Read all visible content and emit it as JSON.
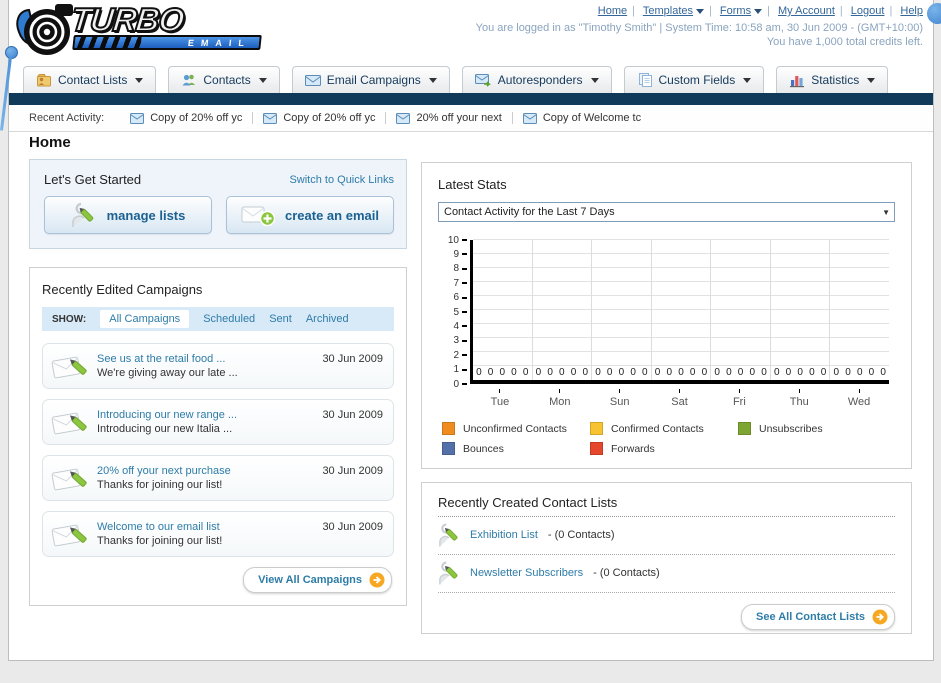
{
  "brand": {
    "name_top": "TURBO",
    "name_bottom": "EMAIL"
  },
  "header": {
    "links": [
      "Home",
      "Templates",
      "Forms",
      "My Account",
      "Logout",
      "Help"
    ],
    "login_info": "You are logged in as \"Timothy Smith\" | System Time: 10:58 am, 30 Jun 2009 - (GMT+10:00)",
    "credits_info": "You have 1,000 total credits left."
  },
  "nav": {
    "tabs": [
      {
        "label": "Contact Lists",
        "icon": "contact-lists-icon"
      },
      {
        "label": "Contacts",
        "icon": "contacts-icon"
      },
      {
        "label": "Email Campaigns",
        "icon": "email-campaigns-icon"
      },
      {
        "label": "Autoresponders",
        "icon": "autoresponders-icon"
      },
      {
        "label": "Custom Fields",
        "icon": "custom-fields-icon"
      },
      {
        "label": "Statistics",
        "icon": "statistics-icon"
      }
    ]
  },
  "recent_activity": {
    "label": "Recent Activity:",
    "items": [
      "Copy of 20% off yc",
      "Copy of 20% off yc",
      "20% off your next",
      "Copy of Welcome tc"
    ]
  },
  "page": {
    "title": "Home"
  },
  "get_started": {
    "title": "Let's Get Started",
    "switch_link": "Switch to Quick Links",
    "manage_lists_label": "manage lists",
    "create_email_label": "create an email"
  },
  "campaigns": {
    "title": "Recently Edited Campaigns",
    "show_label": "SHOW:",
    "filters": [
      "All Campaigns",
      "Scheduled",
      "Sent",
      "Archived"
    ],
    "active_filter": "All Campaigns",
    "items": [
      {
        "title": "See us at the retail food ...",
        "subtitle": "We're giving away our late ...",
        "date": "30 Jun 2009"
      },
      {
        "title": "Introducing our new range ...",
        "subtitle": "Introducing our new Italia ...",
        "date": "30 Jun 2009"
      },
      {
        "title": "20% off your next purchase",
        "subtitle": "Thanks for joining our list!",
        "date": "30 Jun 2009"
      },
      {
        "title": "Welcome to our email list",
        "subtitle": "Thanks for joining our list!",
        "date": "30 Jun 2009"
      }
    ],
    "view_all_label": "View All Campaigns"
  },
  "stats": {
    "title": "Latest Stats",
    "dropdown_value": "Contact Activity for the Last 7 Days"
  },
  "chart_data": {
    "type": "bar",
    "title": "Contact Activity for the Last 7 Days",
    "categories": [
      "Tue",
      "Mon",
      "Sun",
      "Sat",
      "Fri",
      "Thu",
      "Wed"
    ],
    "series": [
      {
        "name": "Unconfirmed Contacts",
        "color": "#F08C1E",
        "values": [
          0,
          0,
          0,
          0,
          0,
          0,
          0
        ]
      },
      {
        "name": "Confirmed Contacts",
        "color": "#F7C331",
        "values": [
          0,
          0,
          0,
          0,
          0,
          0,
          0
        ]
      },
      {
        "name": "Unsubscribes",
        "color": "#7EA431",
        "values": [
          0,
          0,
          0,
          0,
          0,
          0,
          0
        ]
      },
      {
        "name": "Bounces",
        "color": "#5470A8",
        "values": [
          0,
          0,
          0,
          0,
          0,
          0,
          0
        ]
      },
      {
        "name": "Forwards",
        "color": "#E4472B",
        "values": [
          0,
          0,
          0,
          0,
          0,
          0,
          0
        ]
      }
    ],
    "xlabel": "",
    "ylabel": "",
    "ylim": [
      0,
      10
    ],
    "ytick_step": 1,
    "grid": true,
    "legend_position": "bottom",
    "value_labels_shown": true
  },
  "contact_lists": {
    "title": "Recently Created Contact Lists",
    "items": [
      {
        "name": "Exhibition List",
        "detail": "- (0 Contacts)"
      },
      {
        "name": "Newsletter Subscribers",
        "detail": "- (0 Contacts)"
      }
    ],
    "see_all_label": "See All Contact Lists"
  },
  "colors": {
    "navy_bar": "#113A5A",
    "link_teal": "#2E7CA8",
    "header_link_blue": "#336699",
    "accent_orange": "#F7A823",
    "brand_blue": "#2F7BD0"
  }
}
